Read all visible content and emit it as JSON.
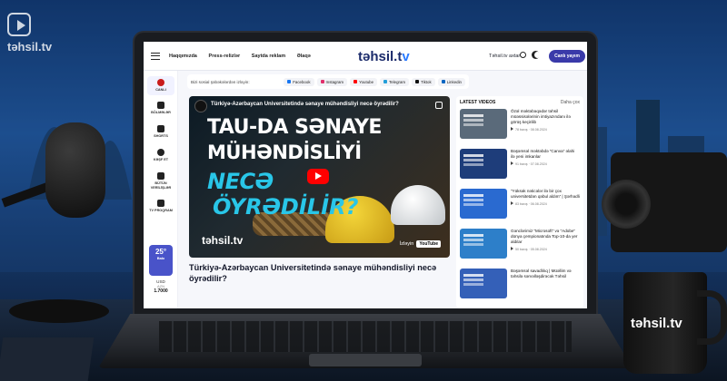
{
  "watermark": {
    "brand": "təhsil.tv"
  },
  "mug": {
    "brand": "təhsil.tv"
  },
  "header": {
    "nav": [
      "Haqqımızda",
      "Press-relizlər",
      "Saytda reklam",
      "Əlaqə"
    ],
    "logo_main": "təhsil.t",
    "logo_accent": "v",
    "search_label": "Təhsil.tv axtar",
    "live_button": "Canlı yayım"
  },
  "sidebar": {
    "items": [
      "CANLI",
      "BÖLMƏLƏR",
      "SHORTS",
      "KƏŞF ET",
      "BÜTÜN VERİLİŞLƏR",
      "TV PROQRAM"
    ],
    "weather": {
      "temp": "25°",
      "city": "Bakı"
    },
    "currency": {
      "label": "USD",
      "sub": "AZN",
      "value": "1.7000"
    }
  },
  "social": {
    "label": "Bizi sosial şəbəkələrdən izləyin:",
    "links": [
      {
        "name": "Facebook",
        "color": "#1877f2"
      },
      {
        "name": "Instagram",
        "color": "#e1306c"
      },
      {
        "name": "Youtube",
        "color": "#ff0000"
      },
      {
        "name": "Telegram",
        "color": "#229ed9"
      },
      {
        "name": "Tiktok",
        "color": "#111111"
      },
      {
        "name": "Linkedin",
        "color": "#0a66c2"
      }
    ]
  },
  "video": {
    "title": "Türkiyə-Azərbaycan Universitetində sənaye mühəndisliyi necə öyrədilir?",
    "line1": "TAU-DA SƏNAYE",
    "line2": "MÜHƏNDİSLİYİ",
    "line3": "NECƏ",
    "line4": "ÖYRƏDİLİR?",
    "logo": "təhsil.tv",
    "watch_on": "İzləyin",
    "platform": "YouTube"
  },
  "article": {
    "title": "Türkiyə-Azərbaycan Universitetində sənaye mühəndisliyi necə öyrədilir?"
  },
  "latest": {
    "heading": "LATEST VIDEOS",
    "more": "Daha çox",
    "items": [
      {
        "text": "Özəl məktəbəqədər təhsil müəssisələrinin imtiyazındanı ilə görüş keçirilib",
        "views": "78 baxış",
        "date": "08.08.2024",
        "color": "#5a6a7a"
      },
      {
        "text": "Bəşəmsəl məktəbdə “Canva” əlahi ilə yeni imkanlar",
        "views": "91 baxış",
        "date": "07.08.2024",
        "color": "#1e3d7a"
      },
      {
        "text": "“Yüksək nəticələr ilə bir çox universitetdən qəbul aldım” | Şərhədli",
        "views": "83 baxış",
        "date": "06.08.2024",
        "color": "#2a6ad0"
      },
      {
        "text": "Gənclərimiz “Microsoft” və “Adobe” dünya çempionatında Top-10-da yer aldılar",
        "views": "50 baxış",
        "date": "05.08.2024",
        "color": "#2d7fc9"
      },
      {
        "text": "Bəşəmsəl savadlılıq | Müəllim və təhsilə sərvəlləşdirəcək Təhsil",
        "views": "",
        "date": "",
        "color": "#3460b8"
      }
    ]
  }
}
